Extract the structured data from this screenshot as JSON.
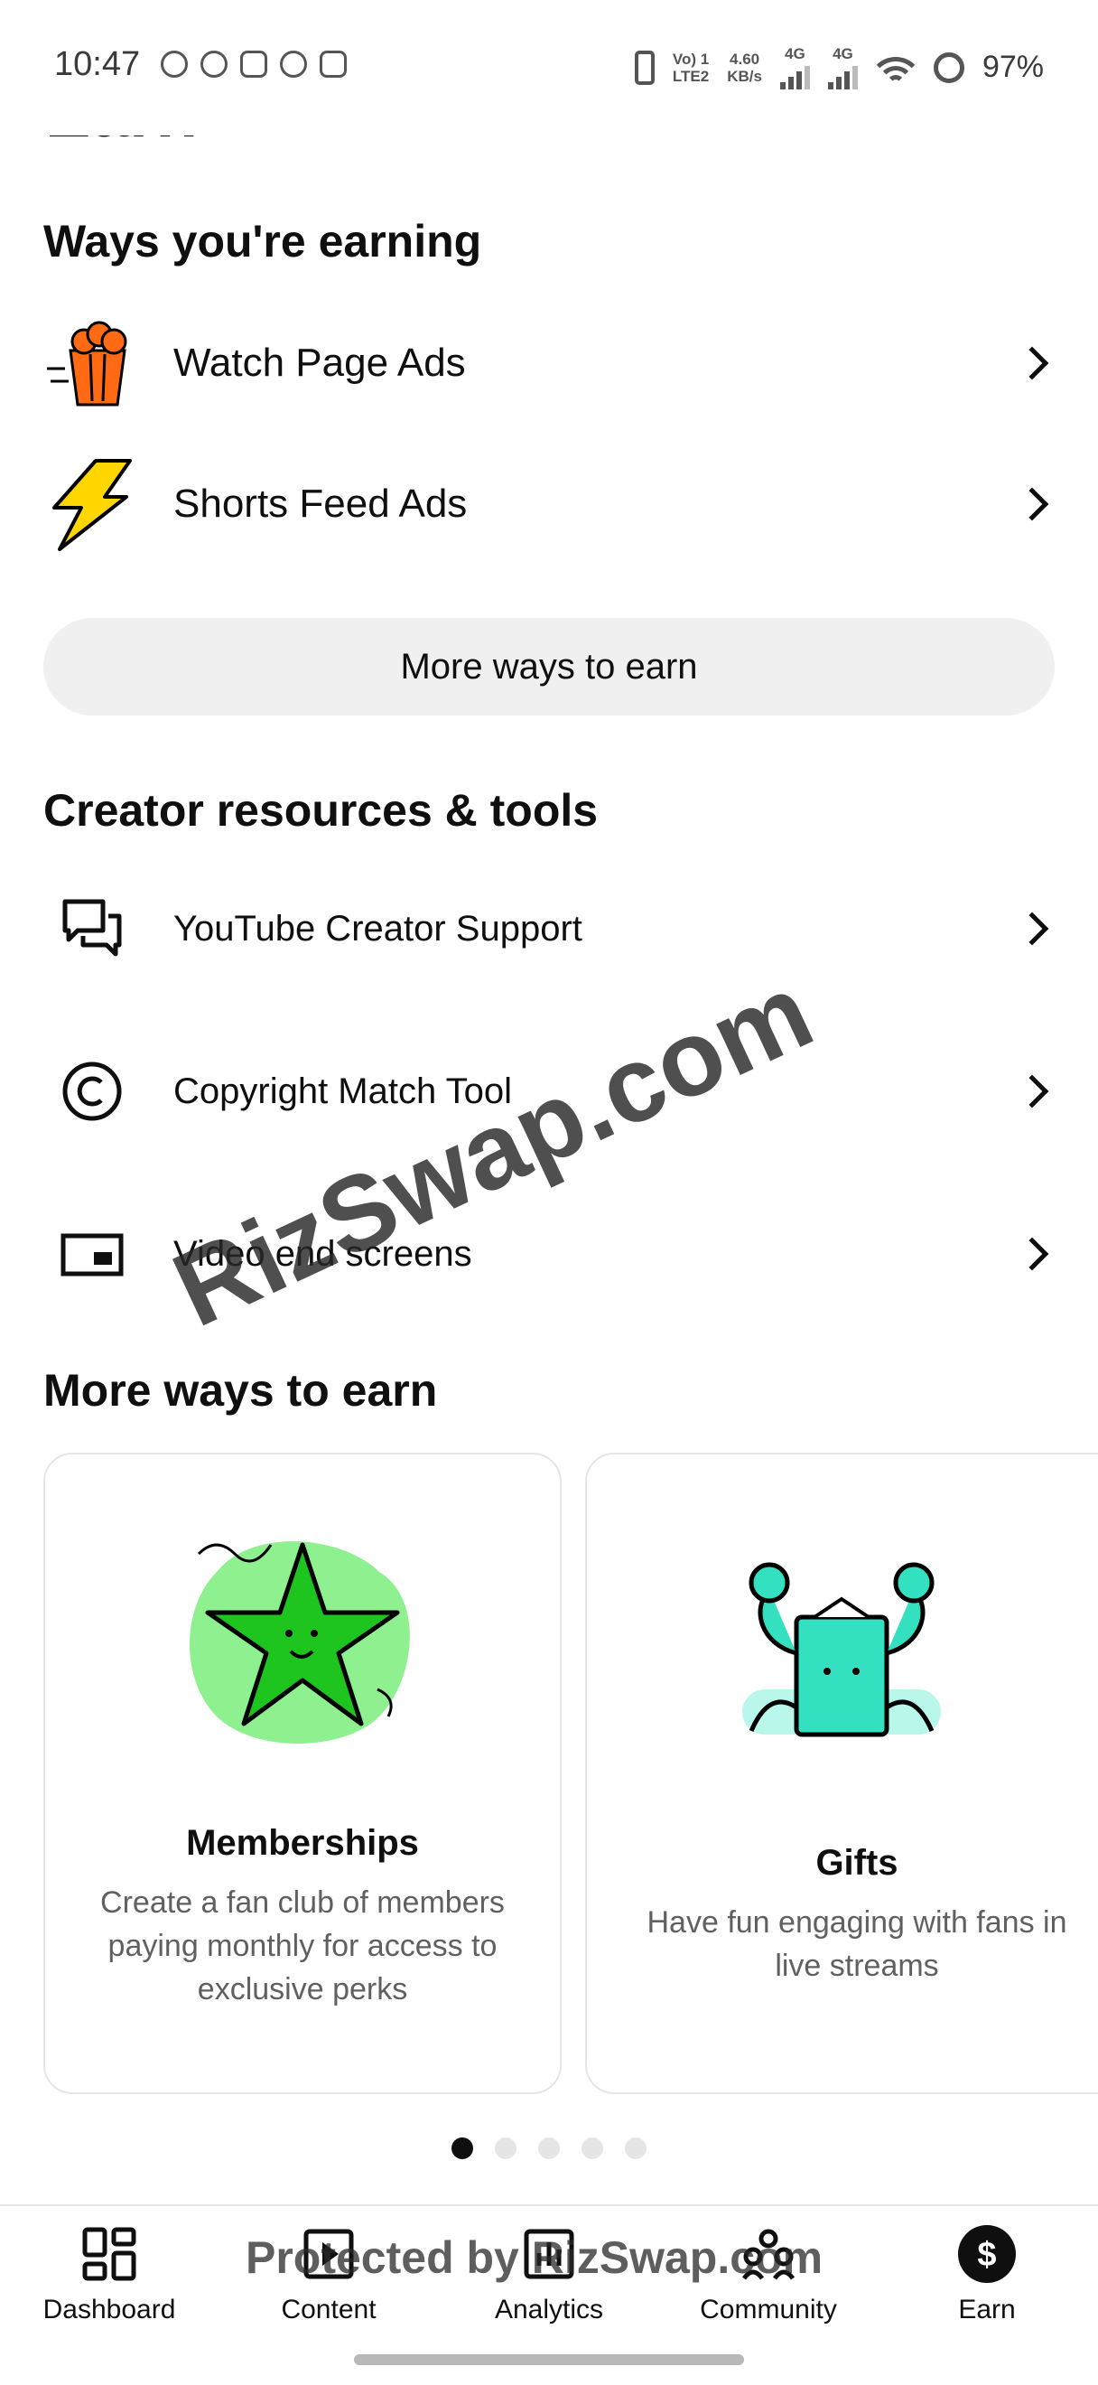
{
  "status_bar": {
    "time": "10:47",
    "network_label_1": "Vo) 1",
    "network_label_2": "LTE2",
    "speed_value": "4.60",
    "speed_unit": "KB/s",
    "sim1_label": "4G",
    "sim2_label": "4G",
    "battery": "97%"
  },
  "page_title": "Earn",
  "earning": {
    "title": "Ways you're earning",
    "items": [
      {
        "label": "Watch Page Ads",
        "icon": "popcorn-icon"
      },
      {
        "label": "Shorts Feed Ads",
        "icon": "lightning-icon"
      }
    ],
    "more_button": "More ways to earn"
  },
  "resources": {
    "title": "Creator resources & tools",
    "items": [
      {
        "label": "YouTube Creator Support",
        "icon": "chat-bubbles-icon"
      },
      {
        "label": "Copyright Match Tool",
        "icon": "copyright-icon"
      },
      {
        "label": "Video end screens",
        "icon": "end-screen-icon"
      }
    ]
  },
  "more_ways": {
    "title": "More ways to earn",
    "cards": [
      {
        "title": "Memberships",
        "description": "Create a fan club of members paying monthly for access to exclusive perks"
      },
      {
        "title": "Gifts",
        "description": "Have fun engaging with fans in live streams"
      }
    ],
    "page_count": 5,
    "active_page": 0
  },
  "bottom_nav": {
    "items": [
      {
        "label": "Dashboard"
      },
      {
        "label": "Content"
      },
      {
        "label": "Analytics"
      },
      {
        "label": "Community"
      },
      {
        "label": "Earn"
      }
    ],
    "active": "Earn"
  },
  "watermarks": {
    "main": "RizSwap.com",
    "footer": "Protected by RizSwap.com"
  },
  "colors": {
    "accent": "#0f0f0f",
    "popcorn": "#ff6a13",
    "lightning": "#ffd600",
    "memberships_green": "#1ec51e",
    "gifts_teal": "#33e0c0"
  }
}
